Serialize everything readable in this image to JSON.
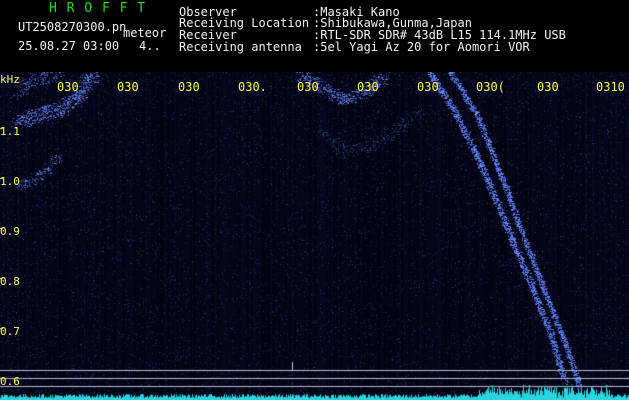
{
  "header": {
    "station": "H R O F F T",
    "filename": "UT2508270300.pn",
    "tag": "meteor",
    "datetime": "25.08.27 03:00",
    "counter": "4..",
    "fields": [
      {
        "label": "Observer",
        "value": ":Masaki Kano"
      },
      {
        "label": "Receiving Location",
        "value": ":Shibukawa,Gunma,Japan"
      },
      {
        "label": "Receiver",
        "value": ":RTL-SDR SDR# 43dB L15 114.1MHz USB"
      },
      {
        "label": "Receiving antenna",
        "value": ":5el Yagi Az 20 for Aomori VOR"
      }
    ]
  },
  "spectrogram": {
    "unit": "kHz",
    "freq_labels": [
      "1.1",
      "1.0",
      "0.9",
      "0.8",
      "0.7",
      "0.6"
    ],
    "time_labels": [
      "030",
      "030",
      "030",
      "030.",
      "030",
      "030",
      "030",
      "030(",
      "030",
      "0310"
    ],
    "colors": {
      "background": "#000008",
      "signal": "#3a5cff",
      "noise_floor": "#28d6e0",
      "reference_lines": "#b8b8d0"
    }
  }
}
